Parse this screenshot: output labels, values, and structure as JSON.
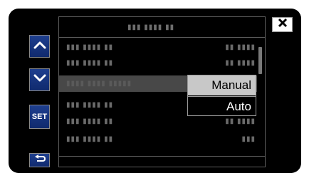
{
  "header": {
    "title": "▮▮▮ ▮▮▮▮ ▮▮"
  },
  "rows": [
    {
      "label": "▮▮▮ ▮▮▮▮ ▮▮",
      "value": "▮▮ ▮▮▮▮"
    },
    {
      "label": "▮▮▮ ▮▮▮▮ ▮▮",
      "value": "▮▮ ▮▮▮▮"
    },
    {
      "label": "▮▮▮▮ ▮▮▮▮ ▮▮▮▮▮",
      "value": ""
    },
    {
      "label": "▮▮▮ ▮▮▮▮ ▮▮",
      "value": "▮▮ ▮▮"
    },
    {
      "label": "▮▮▮ ▮▮▮▮ ▮▮",
      "value": "▮▮ ▮▮▮▮"
    },
    {
      "label": "▮▮▮ ▮▮▮▮ ▮▮",
      "value": "▮▮▮"
    }
  ],
  "buttons": {
    "up_icon": "chevron-up-icon",
    "down_icon": "chevron-down-icon",
    "set_label": "SET",
    "back_icon": "return-arrow-icon",
    "close_icon": "close-icon"
  },
  "popup": {
    "options": [
      "Manual",
      "Auto"
    ],
    "selected": "Manual"
  },
  "colors": {
    "button_blue": "#1b3b8a",
    "screen_bg": "#000000",
    "highlight": "#c8c8c8"
  }
}
